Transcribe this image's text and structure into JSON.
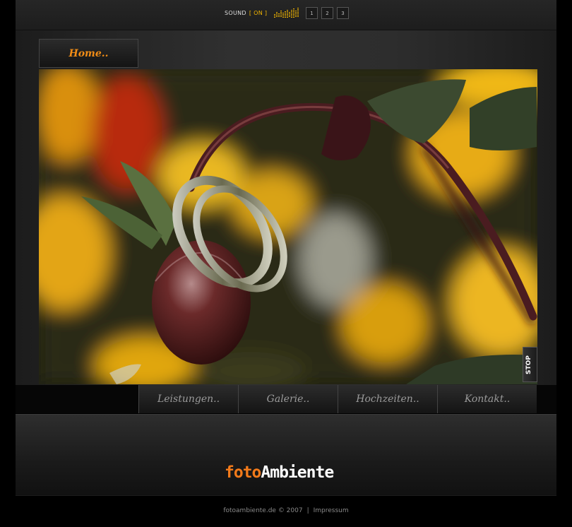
{
  "sound": {
    "label": "SOUND",
    "state": "[ ON ]"
  },
  "equalizer_levels": [
    0.35,
    0.55,
    0.45,
    0.7,
    0.5,
    0.65,
    0.8,
    0.6,
    0.75,
    0.9,
    0.7,
    1.0
  ],
  "tracks": [
    "1",
    "2",
    "3"
  ],
  "home_tab": "Home..",
  "stop_button": "STOP",
  "nav": {
    "items": [
      "Leistungen..",
      "Galerie..",
      "Hochzeiten..",
      "Kontakt.."
    ]
  },
  "logo": {
    "part1": "foto",
    "part2": "Ambiente"
  },
  "footer": {
    "copyright": "fotoambiente.de © 2007",
    "separator": "|",
    "impressum": "Impressum"
  },
  "colors": {
    "accent": "#f27a1a",
    "sound_on": "#f2b500",
    "nav_text": "#9a9a9a"
  }
}
